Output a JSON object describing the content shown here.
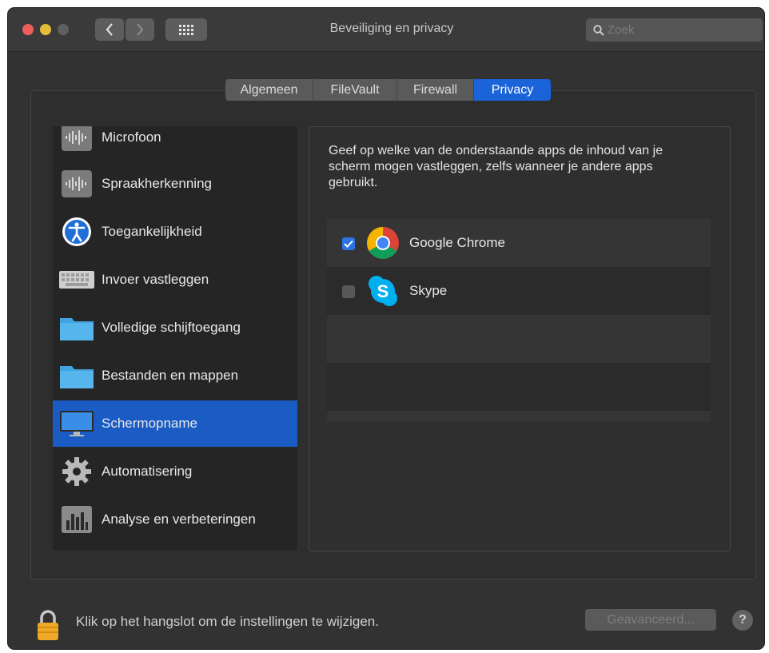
{
  "window": {
    "title": "Beveiliging en privacy"
  },
  "search": {
    "placeholder": "Zoek"
  },
  "tabs": [
    {
      "label": "Algemeen",
      "active": false
    },
    {
      "label": "FileVault",
      "active": false
    },
    {
      "label": "Firewall",
      "active": false
    },
    {
      "label": "Privacy",
      "active": true
    }
  ],
  "sidebar": {
    "items": [
      {
        "label": "Microfoon",
        "icon": "microphone-icon"
      },
      {
        "label": "Spraakherkenning",
        "icon": "speech-recognition-icon"
      },
      {
        "label": "Toegankelijkheid",
        "icon": "accessibility-icon"
      },
      {
        "label": "Invoer vastleggen",
        "icon": "keyboard-icon"
      },
      {
        "label": "Volledige schijftoegang",
        "icon": "folder-icon"
      },
      {
        "label": "Bestanden en mappen",
        "icon": "folder-icon"
      },
      {
        "label": "Schermopname",
        "icon": "display-icon",
        "selected": true
      },
      {
        "label": "Automatisering",
        "icon": "gear-icon"
      },
      {
        "label": "Analyse en verbeteringen",
        "icon": "analytics-icon"
      }
    ]
  },
  "content": {
    "description": "Geef op welke van de onderstaande apps de inhoud van je scherm mogen vastleggen, zelfs wanneer je andere apps gebruikt.",
    "apps": [
      {
        "name": "Google Chrome",
        "checked": true,
        "icon": "chrome-icon"
      },
      {
        "name": "Skype",
        "checked": false,
        "icon": "skype-icon"
      }
    ]
  },
  "footer": {
    "lock_text": "Klik op het hangslot om de instellingen te wijzigen.",
    "advanced_label": "Geavanceerd...",
    "help_label": "?"
  },
  "colors": {
    "accent": "#1a63d9",
    "selection": "#1a5bc4",
    "window_bg": "#323232"
  }
}
